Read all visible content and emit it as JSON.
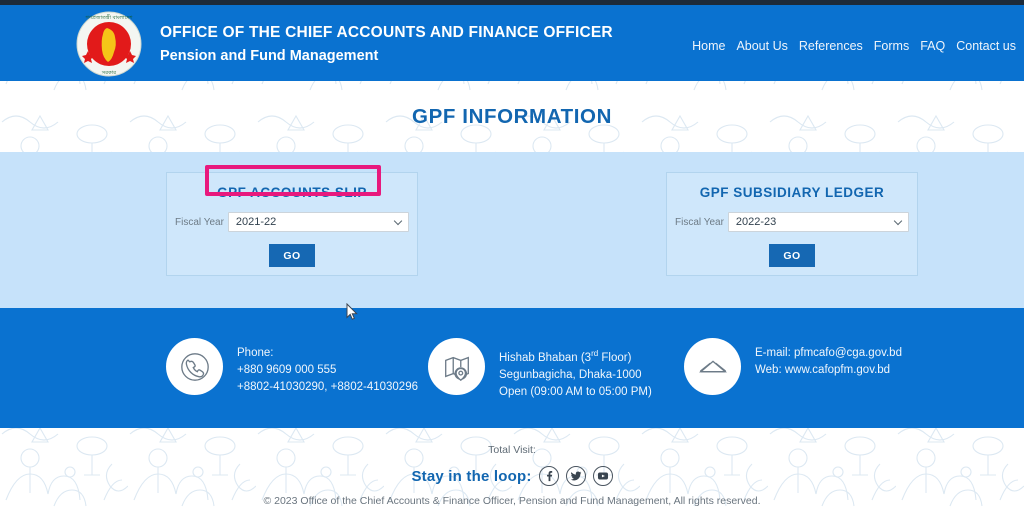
{
  "header": {
    "emblem_alt": "bangladesh-government-emblem",
    "title_line1": "OFFICE OF THE CHIEF ACCOUNTS AND FINANCE OFFICER",
    "title_line2": "Pension and Fund Management",
    "nav": [
      {
        "label": "Home"
      },
      {
        "label": "About Us"
      },
      {
        "label": "References"
      },
      {
        "label": "Forms"
      },
      {
        "label": "FAQ"
      },
      {
        "label": "Contact us"
      }
    ]
  },
  "page": {
    "title": "GPF INFORMATION"
  },
  "panels": {
    "left": {
      "title": "GPF ACCOUNTS SLIP",
      "field_label": "Fiscal Year",
      "selected_year": "2021-22",
      "go_label": "GO",
      "highlighted": true,
      "highlight_color": "#e8197d"
    },
    "right": {
      "title": "GPF SUBSIDIARY LEDGER",
      "field_label": "Fiscal Year",
      "selected_year": "2022-23",
      "go_label": "GO",
      "highlighted": false
    }
  },
  "footer": {
    "phone": {
      "icon": "phone-icon",
      "line1": "Phone:",
      "line2": "+880 9609 000 555",
      "line3": "+8802-41030290, +8802-41030296"
    },
    "address": {
      "icon": "map-pin-icon",
      "line1_a": "Hishab Bhaban (3",
      "line1_sup": "rd",
      "line1_b": " Floor)",
      "line2": "Segunbagicha, Dhaka-1000",
      "line3": "Open (09:00 AM to 05:00 PM)"
    },
    "email": {
      "icon": "envelope-icon",
      "line1": "E-mail: pfmcafo@cga.gov.bd",
      "line2": "Web: www.cafopfm.gov.bd"
    }
  },
  "bottom": {
    "total_visit": "Total Visit:",
    "loop_label": "Stay in the loop:",
    "social": [
      {
        "name": "facebook-icon",
        "glyph": "f"
      },
      {
        "name": "twitter-icon",
        "glyph": "t"
      },
      {
        "name": "youtube-icon",
        "glyph": "y"
      }
    ],
    "copyright": "© 2023 Office of the Chief Accounts & Finance Officer, Pension and Fund Management, All rights reserved."
  },
  "colors": {
    "header_blue": "#0a72d0",
    "band_blue": "#c6e2fa",
    "accent_pink": "#e8197d",
    "title_blue": "#1266b0",
    "button_blue": "#1668b3"
  }
}
